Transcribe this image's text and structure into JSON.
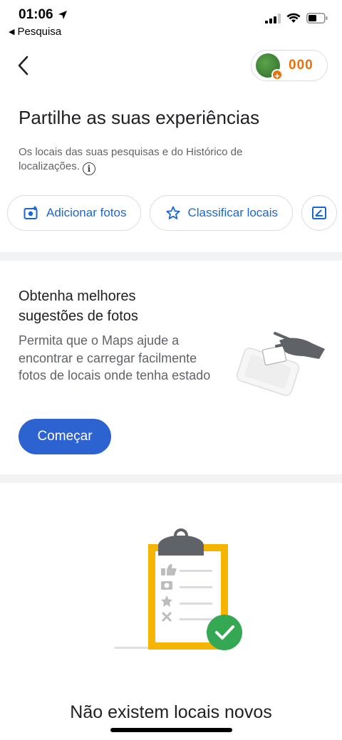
{
  "status_bar": {
    "time": "01:06",
    "back_app_label": "Pesquisa"
  },
  "header": {
    "points": "000"
  },
  "contribute": {
    "title": "Partilhe as suas experiências",
    "subtitle": "Os locais das suas pesquisas e do Histórico de localizações."
  },
  "chips": [
    {
      "label": "Adicionar fotos",
      "icon": "add-photo-icon"
    },
    {
      "label": "Classificar locais",
      "icon": "star-icon"
    },
    {
      "label": "",
      "icon": "edit-review-icon"
    }
  ],
  "suggestion_card": {
    "title": "Obtenha melhores sugestões de fotos",
    "text": "Permita que o Maps ajude a encontrar e carregar facilmente fotos de locais onde tenha estado",
    "button_label": "Começar"
  },
  "empty_state": {
    "title": "Não existem locais novos"
  },
  "colors": {
    "accent_blue": "#1967d2",
    "button_blue": "#2d63d1",
    "points_orange": "#e8710a",
    "check_green": "#34a853",
    "clipboard_yellow": "#f4b400"
  }
}
